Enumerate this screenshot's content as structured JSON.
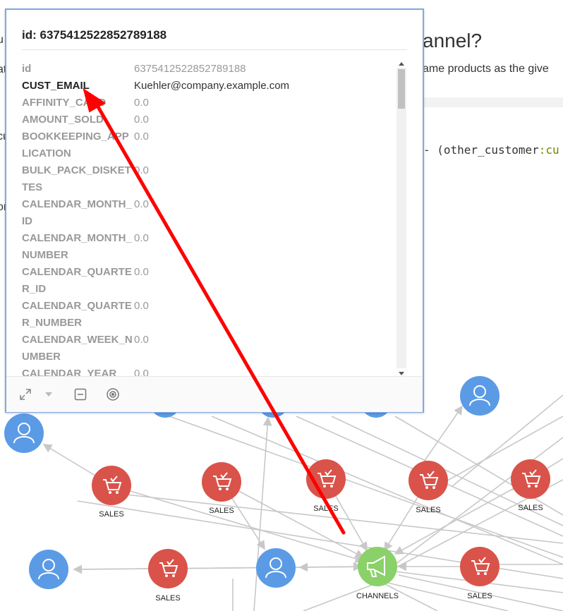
{
  "background": {
    "title_fragment": "annel?",
    "description_fragment": "ame products as the give",
    "code_fragment_plain": "- (other_customer",
    "code_fragment_type": ":cu",
    "left_fragments": [
      "u",
      "at",
      "cu",
      "or"
    ]
  },
  "panel": {
    "title": "id: 6375412522852789188",
    "properties": [
      {
        "key": "id",
        "value": "6375412522852789188",
        "highlight": false
      },
      {
        "key": "CUST_EMAIL",
        "value": "Kuehler@company.example.com",
        "highlight": true
      },
      {
        "key": "AFFINITY_CARD",
        "value": "0.0",
        "highlight": false
      },
      {
        "key": "AMOUNT_SOLD",
        "value": "0.0",
        "highlight": false
      },
      {
        "key": "BOOKKEEPING_APPLICATION",
        "value": "0.0",
        "highlight": false
      },
      {
        "key": "BULK_PACK_DISKETTES",
        "value": "0.0",
        "highlight": false
      },
      {
        "key": "CALENDAR_MONTH_ID",
        "value": "0.0",
        "highlight": false
      },
      {
        "key": "CALENDAR_MONTH_NUMBER",
        "value": "0.0",
        "highlight": false
      },
      {
        "key": "CALENDAR_QUARTER_ID",
        "value": "0.0",
        "highlight": false
      },
      {
        "key": "CALENDAR_QUARTER_NUMBER",
        "value": "0.0",
        "highlight": false
      },
      {
        "key": "CALENDAR_WEEK_NUMBER",
        "value": "0.0",
        "highlight": false
      },
      {
        "key": "CALENDAR_YEAR",
        "value": "0.0",
        "highlight": false
      }
    ],
    "footer_icons": [
      "expand-icon",
      "dropdown-arrow-icon",
      "collapse-icon",
      "focus-target-icon"
    ]
  },
  "graph": {
    "sales_label": "SALES",
    "channels_label": "CHANNELS",
    "colors": {
      "customer": "#5b9be6",
      "sales": "#d9534a",
      "channels": "#8bd16a",
      "edge": "#c8c8c8",
      "annotation_arrow": "#ff0000"
    }
  }
}
